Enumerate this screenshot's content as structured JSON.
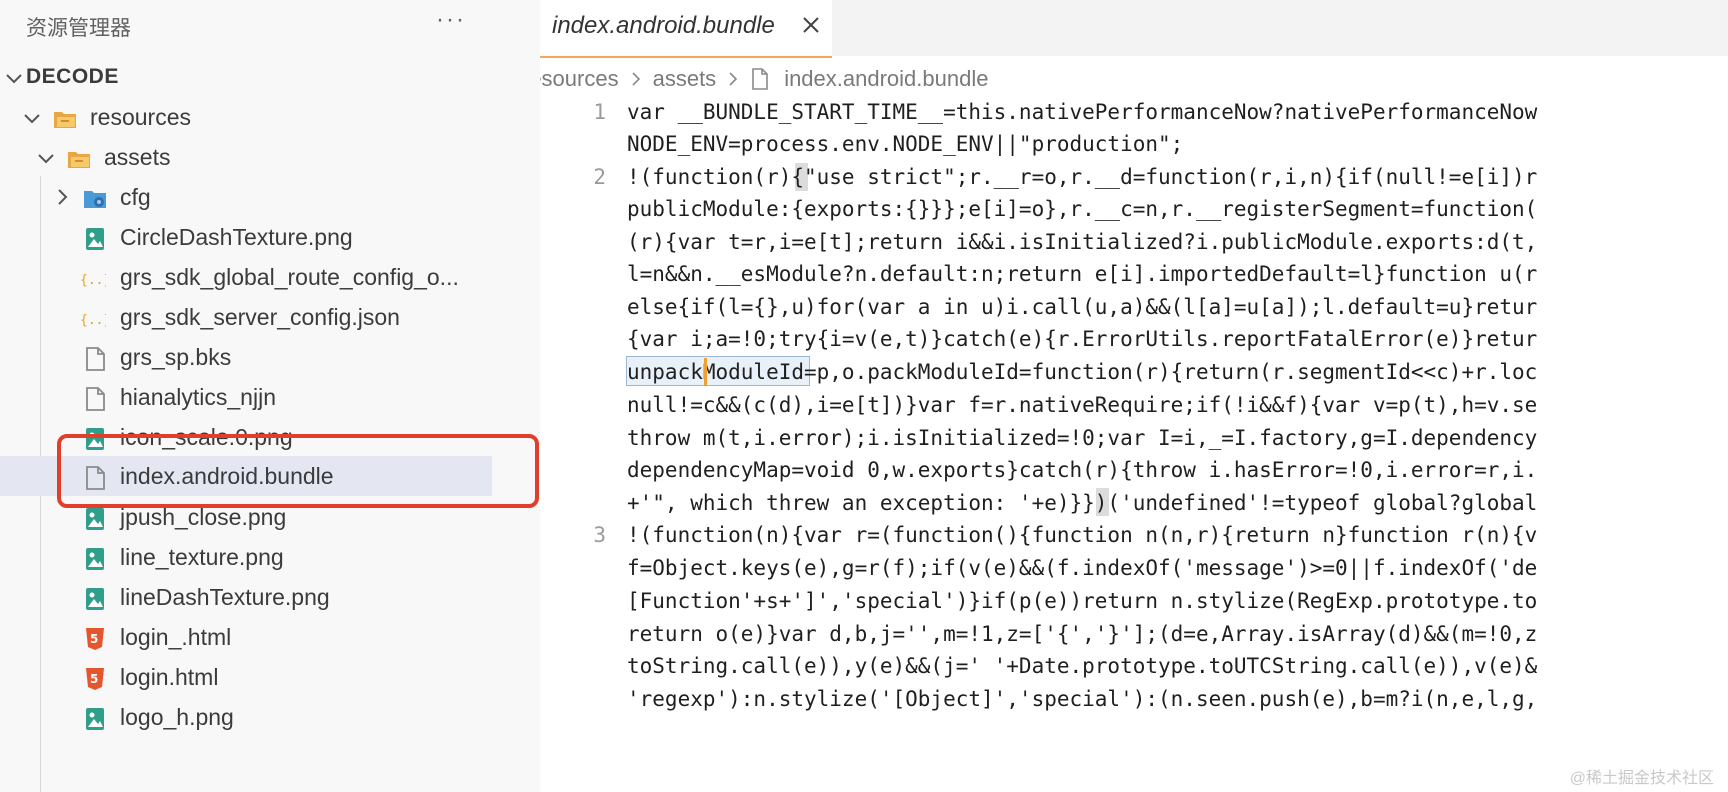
{
  "explorer": {
    "title": "资源管理器",
    "more": "···",
    "root": "DECODE",
    "items": [
      {
        "label": "resources",
        "icon": "folder-open-icon"
      },
      {
        "label": "assets",
        "icon": "folder-open-icon"
      },
      {
        "label": "cfg",
        "icon": "folder-gear-icon"
      },
      {
        "label": "CircleDashTexture.png",
        "icon": "image-file-icon"
      },
      {
        "label": "grs_sdk_global_route_config_o...",
        "icon": "json-file-icon"
      },
      {
        "label": "grs_sdk_server_config.json",
        "icon": "json-file-icon"
      },
      {
        "label": "grs_sp.bks",
        "icon": "file-icon"
      },
      {
        "label": "hianalytics_njjn",
        "icon": "file-icon"
      },
      {
        "label": "icon_scale.0.png",
        "icon": "image-file-icon"
      },
      {
        "label": "index.android.bundle",
        "icon": "file-icon",
        "selected": true
      },
      {
        "label": "jpush_close.png",
        "icon": "image-file-icon"
      },
      {
        "label": "line_texture.png",
        "icon": "image-file-icon"
      },
      {
        "label": "lineDashTexture.png",
        "icon": "image-file-icon"
      },
      {
        "label": "login_.html",
        "icon": "html-file-icon"
      },
      {
        "label": "login.html",
        "icon": "html-file-icon"
      },
      {
        "label": "logo_h.png",
        "icon": "image-file-icon"
      }
    ]
  },
  "editor": {
    "tab": {
      "title": "index.android.bundle"
    },
    "breadcrumb": [
      "resources",
      "assets",
      "index.android.bundle"
    ],
    "line_numbers": [
      "1",
      "2",
      "3"
    ],
    "lines": [
      "var __BUNDLE_START_TIME__=this.nativePerformanceNow?nativePerformanceNow",
      "NODE_ENV=process.env.NODE_ENV||\"production\";",
      "!(function(r){\"use strict\";r.__r=o,r.__d=function(r,i,n){if(null!=e[i])r",
      "publicModule:{exports:{}}};e[i]=o},r.__c=n,r.__registerSegment=function(",
      "(r){var t=r,i=e[t];return i&&i.isInitialized?i.publicModule.exports:d(t,",
      "l=n&&n.__esModule?n.default:n;return e[i].importedDefault=l}function u(r",
      "else{if(l={},u)for(var a in u)i.call(u,a)&&(l[a]=u[a]);l.default=u}retur",
      "{var i;a=!0;try{i=v(e,t)}catch(e){r.ErrorUtils.reportFatalError(e)}retur",
      "unpackModuleId=p,o.packModuleId=function(r){return(r.segmentId<<c)+r.loc",
      "null!=c&&(c(d),i=e[t])}var f=r.nativeRequire;if(!i&&f){var v=p(t),h=v.se",
      "throw m(t,i.error);i.isInitialized=!0;var I=i,_=I.factory,g=I.dependency",
      "dependencyMap=void 0,w.exports}catch(r){throw i.hasError=!0,i.error=r,i.",
      "+'\", which threw an exception: '+e)}})('undefined'!=typeof global?global",
      "!(function(n){var r=(function(){function n(n,r){return n}function r(n){v",
      "f=Object.keys(e),g=r(f);if(v(e)&&(f.indexOf('message')>=0||f.indexOf('de",
      "[Function'+s+']','special')}if(p(e))return n.stylize(RegExp.prototype.to",
      "return o(e)}var d,b,j='',m=!1,z=['{','}'];(d=e,Array.isArray(d)&&(m=!0,z",
      "toString.call(e)),y(e)&&(j=' '+Date.prototype.toUTCString.call(e)),v(e)&",
      "'regexp'):n.stylize('[Object]','special'):(n.seen.push(e),b=m?i(n,e,l,g,"
    ],
    "watermark": "@稀土掘金技术社区"
  }
}
